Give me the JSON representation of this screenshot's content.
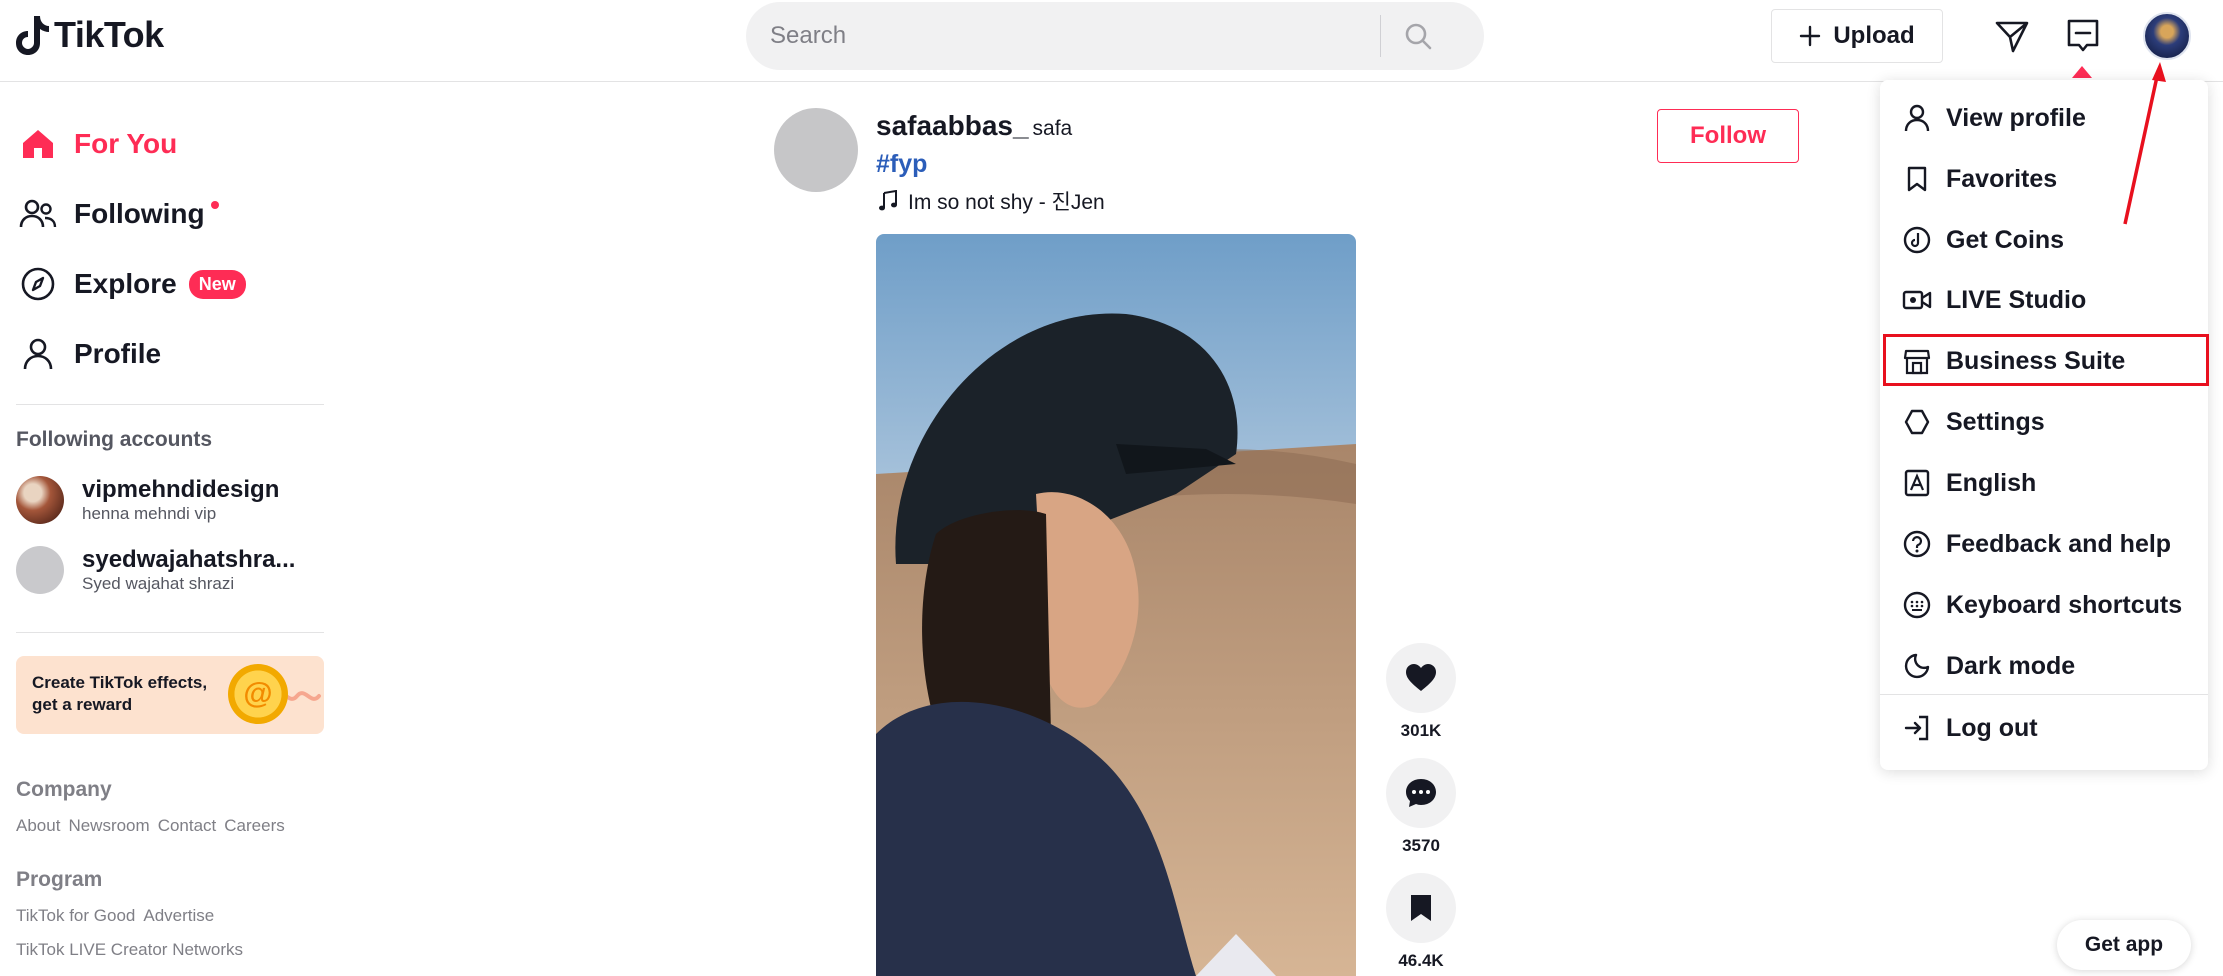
{
  "header": {
    "logo_text": "TikTok",
    "search_placeholder": "Search",
    "upload_label": "Upload"
  },
  "sidebar": {
    "nav": [
      {
        "label": "For You",
        "icon": "home-icon",
        "active": true
      },
      {
        "label": "Following",
        "icon": "following-icon",
        "dot": true
      },
      {
        "label": "Explore",
        "icon": "compass-icon",
        "badge": "New"
      },
      {
        "label": "Profile",
        "icon": "profile-icon"
      }
    ],
    "following_title": "Following accounts",
    "accounts": [
      {
        "name": "vipmehndidesign",
        "sub": "henna mehndi vip"
      },
      {
        "name": "syedwajahatshra...",
        "sub": "Syed wajahat shrazi"
      }
    ],
    "promo_line1": "Create TikTok effects,",
    "promo_line2": "get a reward",
    "company_title": "Company",
    "company_links": [
      "About",
      "Newsroom",
      "Contact",
      "Careers"
    ],
    "program_title": "Program",
    "program_links": [
      "TikTok for Good",
      "Advertise"
    ],
    "program_links2": [
      "TikTok LIVE Creator Networks"
    ]
  },
  "post": {
    "username": "safaabbas_",
    "nickname": "safa",
    "hashtag": "#fyp",
    "music": "Im so not shy - 진Jen",
    "follow_label": "Follow",
    "likes": "301K",
    "comments": "3570",
    "saves": "46.4K"
  },
  "menu": {
    "items": [
      {
        "label": "View profile",
        "icon": "user-icon"
      },
      {
        "label": "Favorites",
        "icon": "bookmark-icon"
      },
      {
        "label": "Get Coins",
        "icon": "coin-icon"
      },
      {
        "label": "LIVE Studio",
        "icon": "live-camera-icon"
      },
      {
        "label": "Business Suite",
        "icon": "store-icon"
      },
      {
        "label": "Settings",
        "icon": "gear-icon"
      },
      {
        "label": "English",
        "icon": "language-icon"
      },
      {
        "label": "Feedback and help",
        "icon": "help-icon"
      },
      {
        "label": "Keyboard shortcuts",
        "icon": "keyboard-icon"
      },
      {
        "label": "Dark mode",
        "icon": "moon-icon"
      }
    ],
    "logout_label": "Log out"
  },
  "get_app_label": "Get app",
  "colors": {
    "accent": "#fe2c55",
    "hashtag": "#2b5db9",
    "annotation": "#e8101e"
  }
}
